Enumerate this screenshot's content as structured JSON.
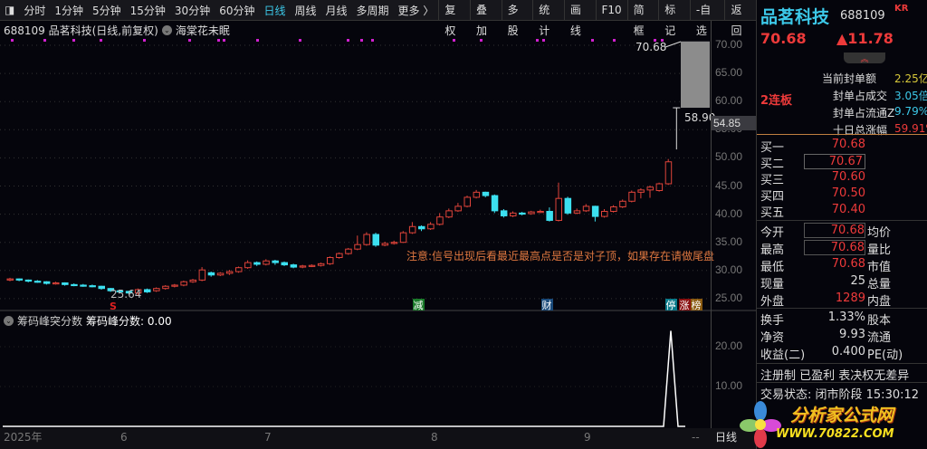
{
  "toolbar": {
    "periods": [
      "分时",
      "1分钟",
      "5分钟",
      "15分钟",
      "30分钟",
      "60分钟",
      "日线",
      "周线",
      "月线",
      "多周期",
      "更多 〉"
    ],
    "active": "日线",
    "buttons": [
      "复权",
      "叠加",
      "多股",
      "统计",
      "画线",
      "F10",
      "简框",
      "标记",
      "-自选",
      "返回"
    ]
  },
  "chart_header": {
    "title": "688109 品茗科技(日线,前复权)",
    "indicator": "海棠花未眠"
  },
  "price_axis": [
    "70.00",
    "65.00",
    "60.00",
    "55.00",
    "50.00",
    "45.00",
    "40.00",
    "35.00",
    "30.00",
    "25.00"
  ],
  "price_marker": "54.85",
  "annotations": {
    "high": "70.68",
    "limit": "58.90",
    "low": "25.64",
    "note": "注意:信号出现后看最近最高点是否是对子顶，如果存在请做尾盘",
    "signals": [
      "减",
      "财",
      "停",
      "涨",
      "榜"
    ],
    "s_mark": "S"
  },
  "candles": [
    [
      28.3,
      28.5,
      28.7,
      28.1
    ],
    [
      28.5,
      28.3,
      28.6,
      28.1
    ],
    [
      28.3,
      28.1,
      28.4,
      27.9
    ],
    [
      28.1,
      28.0,
      28.3,
      27.8
    ],
    [
      28.0,
      27.7,
      28.1,
      27.5
    ],
    [
      27.7,
      27.8,
      28.0,
      27.5
    ],
    [
      27.8,
      27.5,
      27.9,
      27.3
    ],
    [
      27.5,
      27.4,
      27.7,
      27.2
    ],
    [
      27.4,
      27.3,
      27.6,
      27.1
    ],
    [
      27.3,
      27.2,
      27.5,
      27.0
    ],
    [
      27.2,
      26.8,
      27.3,
      26.6
    ],
    [
      26.8,
      26.4,
      26.9,
      26.2
    ],
    [
      26.4,
      26.3,
      26.6,
      26.1
    ],
    [
      26.3,
      26.0,
      26.4,
      25.8
    ],
    [
      26.0,
      26.6,
      26.8,
      25.64
    ],
    [
      26.6,
      26.2,
      26.8,
      26.0
    ],
    [
      26.4,
      26.8,
      27.0,
      26.2
    ],
    [
      26.8,
      27.2,
      27.4,
      26.6
    ],
    [
      27.2,
      27.4,
      27.6,
      27.0
    ],
    [
      27.4,
      28.0,
      28.2,
      27.2
    ],
    [
      28.0,
      28.3,
      28.5,
      27.8
    ],
    [
      28.3,
      30.1,
      30.6,
      28.1
    ],
    [
      29.6,
      29.2,
      29.8,
      28.9
    ],
    [
      29.2,
      29.5,
      29.7,
      29.0
    ],
    [
      29.5,
      29.8,
      30.1,
      29.2
    ],
    [
      29.8,
      30.5,
      30.7,
      29.6
    ],
    [
      30.5,
      31.4,
      31.8,
      30.3
    ],
    [
      31.4,
      31.1,
      31.6,
      30.8
    ],
    [
      31.1,
      31.7,
      32.0,
      30.9
    ],
    [
      31.7,
      31.4,
      31.9,
      31.0
    ],
    [
      31.4,
      31.0,
      31.6,
      30.8
    ],
    [
      31.0,
      30.6,
      31.2,
      30.4
    ],
    [
      30.6,
      30.8,
      31.0,
      30.4
    ],
    [
      30.8,
      30.9,
      31.1,
      30.6
    ],
    [
      30.9,
      31.2,
      31.4,
      30.7
    ],
    [
      31.2,
      32.3,
      32.5,
      31.0
    ],
    [
      32.3,
      33.0,
      33.2,
      32.1
    ],
    [
      33.0,
      33.8,
      34.0,
      32.8
    ],
    [
      33.8,
      34.6,
      36.2,
      33.6
    ],
    [
      34.6,
      36.4,
      36.8,
      34.4
    ],
    [
      36.4,
      34.5,
      36.7,
      34.2
    ],
    [
      34.5,
      34.8,
      35.1,
      34.3
    ],
    [
      34.8,
      35.0,
      35.3,
      34.6
    ],
    [
      35.0,
      36.7,
      37.0,
      34.9
    ],
    [
      36.7,
      37.8,
      38.6,
      36.5
    ],
    [
      37.8,
      37.4,
      38.0,
      37.0
    ],
    [
      37.4,
      38.2,
      38.6,
      37.2
    ],
    [
      38.2,
      39.5,
      40.2,
      38.0
    ],
    [
      39.5,
      40.6,
      41.0,
      39.3
    ],
    [
      40.6,
      41.4,
      42.0,
      40.4
    ],
    [
      41.4,
      43.0,
      43.3,
      41.2
    ],
    [
      43.0,
      43.9,
      44.3,
      42.8
    ],
    [
      43.9,
      43.3,
      44.0,
      43.0
    ],
    [
      43.3,
      40.6,
      43.5,
      40.2
    ],
    [
      40.6,
      39.7,
      40.9,
      39.4
    ],
    [
      39.7,
      40.2,
      40.5,
      39.5
    ],
    [
      40.2,
      40.1,
      40.4,
      39.8
    ],
    [
      40.1,
      40.4,
      40.6,
      39.9
    ],
    [
      40.4,
      40.5,
      40.8,
      40.2
    ],
    [
      40.5,
      38.9,
      41.2,
      38.7
    ],
    [
      38.9,
      42.8,
      45.6,
      38.7
    ],
    [
      42.8,
      40.2,
      43.1,
      39.9
    ],
    [
      40.2,
      40.6,
      41.0,
      40.0
    ],
    [
      40.6,
      41.4,
      41.8,
      40.4
    ],
    [
      41.4,
      39.6,
      41.5,
      38.7
    ],
    [
      39.6,
      40.5,
      40.9,
      39.4
    ],
    [
      40.5,
      41.3,
      41.6,
      40.3
    ],
    [
      41.3,
      42.3,
      42.6,
      41.1
    ],
    [
      42.3,
      43.9,
      44.2,
      42.1
    ],
    [
      43.9,
      44.3,
      44.6,
      42.8
    ],
    [
      44.3,
      44.8,
      45.1,
      42.9
    ],
    [
      44.2,
      45.4,
      45.6,
      44.0
    ],
    [
      45.4,
      49.3,
      49.8,
      45.2
    ],
    [
      51.5,
      58.9,
      58.9,
      51.5
    ]
  ],
  "dots": [
    12,
    48,
    80,
    110,
    158,
    208,
    240,
    246,
    283,
    330,
    383,
    398,
    410,
    500,
    530,
    592,
    599,
    653,
    677,
    722,
    730
  ],
  "lower_pane": {
    "title": "筹码峰突分数",
    "value_label": "筹码峰分数: 0.00",
    "axis": [
      "20.00",
      "10.00"
    ],
    "peak": 24
  },
  "time_axis": [
    "2025年",
    "6",
    "7",
    "8",
    "9",
    "--",
    "日线"
  ],
  "quote": {
    "name": "品茗科技",
    "code": "688109",
    "tag": "KR",
    "price": "70.68",
    "change": "▲11.78",
    "streak": "2连板",
    "seal": [
      {
        "k": "当前封单额",
        "v": "2.25亿",
        "c": "yel"
      },
      {
        "k": "封单占成交",
        "v": "3.05倍",
        "c": "cyan"
      },
      {
        "k": "封单占流通Z",
        "v": "9.79%",
        "c": "cyan"
      },
      {
        "k": "十日总涨幅",
        "v": "59.91%",
        "c": "red"
      }
    ],
    "bids": [
      {
        "k": "买一",
        "v": "70.68"
      },
      {
        "k": "买二",
        "v": "70.67"
      },
      {
        "k": "买三",
        "v": "70.60"
      },
      {
        "k": "买四",
        "v": "70.50"
      },
      {
        "k": "买五",
        "v": "70.40"
      }
    ],
    "stats": [
      {
        "k": "今开",
        "v": "70.68",
        "r": "均价",
        "c": "red"
      },
      {
        "k": "最高",
        "v": "70.68",
        "r": "量比",
        "c": "red"
      },
      {
        "k": "最低",
        "v": "70.68",
        "r": "市值",
        "c": "red"
      },
      {
        "k": "现量",
        "v": "25",
        "r": "总量",
        "c": "wht"
      },
      {
        "k": "外盘",
        "v": "1289",
        "r": "内盘",
        "c": "red"
      }
    ],
    "fin": [
      {
        "k": "换手",
        "v": "1.33%",
        "r": "股本"
      },
      {
        "k": "净资",
        "v": "9.93",
        "r": "流通"
      },
      {
        "k": "收益(二)",
        "v": "0.400",
        "r": "PE(动)"
      }
    ],
    "tags": "注册制 已盈利 表决权无差异",
    "status": "交易状态: 闭市阶段 15:30:12"
  },
  "watermark": {
    "name": "分析家公式网",
    "url": "WWW.70822.COM"
  }
}
